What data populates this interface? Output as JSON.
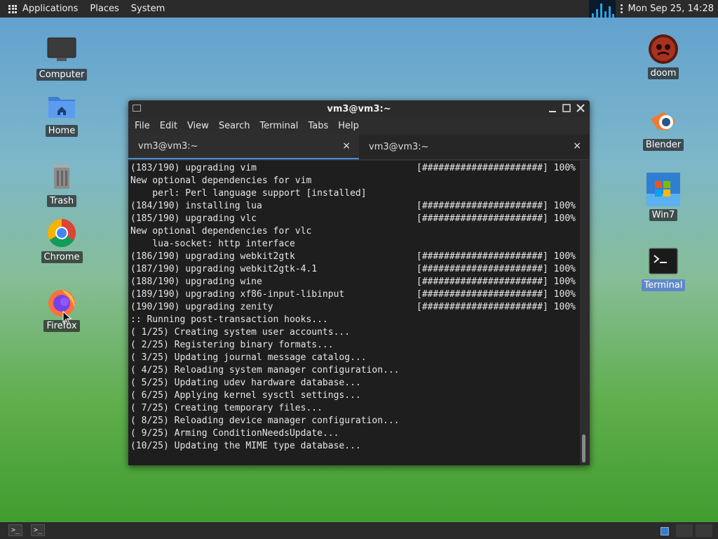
{
  "top_panel": {
    "menus": [
      "Applications",
      "Places",
      "System"
    ],
    "clock": "Mon Sep 25, 14:28"
  },
  "desktop_left": [
    {
      "label": "Computer",
      "icon": "monitor-icon"
    },
    {
      "label": "Home",
      "icon": "home-folder-icon"
    },
    {
      "label": "Trash",
      "icon": "trash-icon"
    },
    {
      "label": "Chrome",
      "icon": "chrome-icon"
    },
    {
      "label": "Firefox",
      "icon": "firefox-icon"
    }
  ],
  "desktop_right": [
    {
      "label": "doom",
      "icon": "doom-icon"
    },
    {
      "label": "Blender",
      "icon": "blender-icon"
    },
    {
      "label": "Win7",
      "icon": "win7-icon"
    },
    {
      "label": "Terminal",
      "icon": "terminal-icon"
    }
  ],
  "terminal": {
    "title": "vm3@vm3:~",
    "menu": [
      "File",
      "Edit",
      "View",
      "Search",
      "Terminal",
      "Tabs",
      "Help"
    ],
    "tabs": [
      "vm3@vm3:~",
      "vm3@vm3:~"
    ],
    "close_glyph": "×",
    "progress_bar": "[######################] 100%",
    "lines": [
      {
        "text": "(183/190) upgrading vim",
        "bar": true
      },
      {
        "text": "New optional dependencies for vim",
        "bar": false
      },
      {
        "text": "    perl: Perl language support [installed]",
        "bar": false
      },
      {
        "text": "(184/190) installing lua",
        "bar": true
      },
      {
        "text": "(185/190) upgrading vlc",
        "bar": true
      },
      {
        "text": "New optional dependencies for vlc",
        "bar": false
      },
      {
        "text": "    lua-socket: http interface",
        "bar": false
      },
      {
        "text": "(186/190) upgrading webkit2gtk",
        "bar": true
      },
      {
        "text": "(187/190) upgrading webkit2gtk-4.1",
        "bar": true
      },
      {
        "text": "(188/190) upgrading wine",
        "bar": true
      },
      {
        "text": "(189/190) upgrading xf86-input-libinput",
        "bar": true
      },
      {
        "text": "(190/190) upgrading zenity",
        "bar": true
      },
      {
        "text": ":: Running post-transaction hooks...",
        "bar": false
      },
      {
        "text": "( 1/25) Creating system user accounts...",
        "bar": false
      },
      {
        "text": "( 2/25) Registering binary formats...",
        "bar": false
      },
      {
        "text": "( 3/25) Updating journal message catalog...",
        "bar": false
      },
      {
        "text": "( 4/25) Reloading system manager configuration...",
        "bar": false
      },
      {
        "text": "( 5/25) Updating udev hardware database...",
        "bar": false
      },
      {
        "text": "( 6/25) Applying kernel sysctl settings...",
        "bar": false
      },
      {
        "text": "( 7/25) Creating temporary files...",
        "bar": false
      },
      {
        "text": "( 8/25) Reloading device manager configuration...",
        "bar": false
      },
      {
        "text": "( 9/25) Arming ConditionNeedsUpdate...",
        "bar": false
      },
      {
        "text": "(10/25) Updating the MIME type database...",
        "bar": false
      }
    ]
  },
  "colors": {
    "panel": "#2b2b2b",
    "console_bg": "#1e1e1e",
    "tab_accent": "#4a90d9",
    "selected_label": "#5f88c8"
  }
}
